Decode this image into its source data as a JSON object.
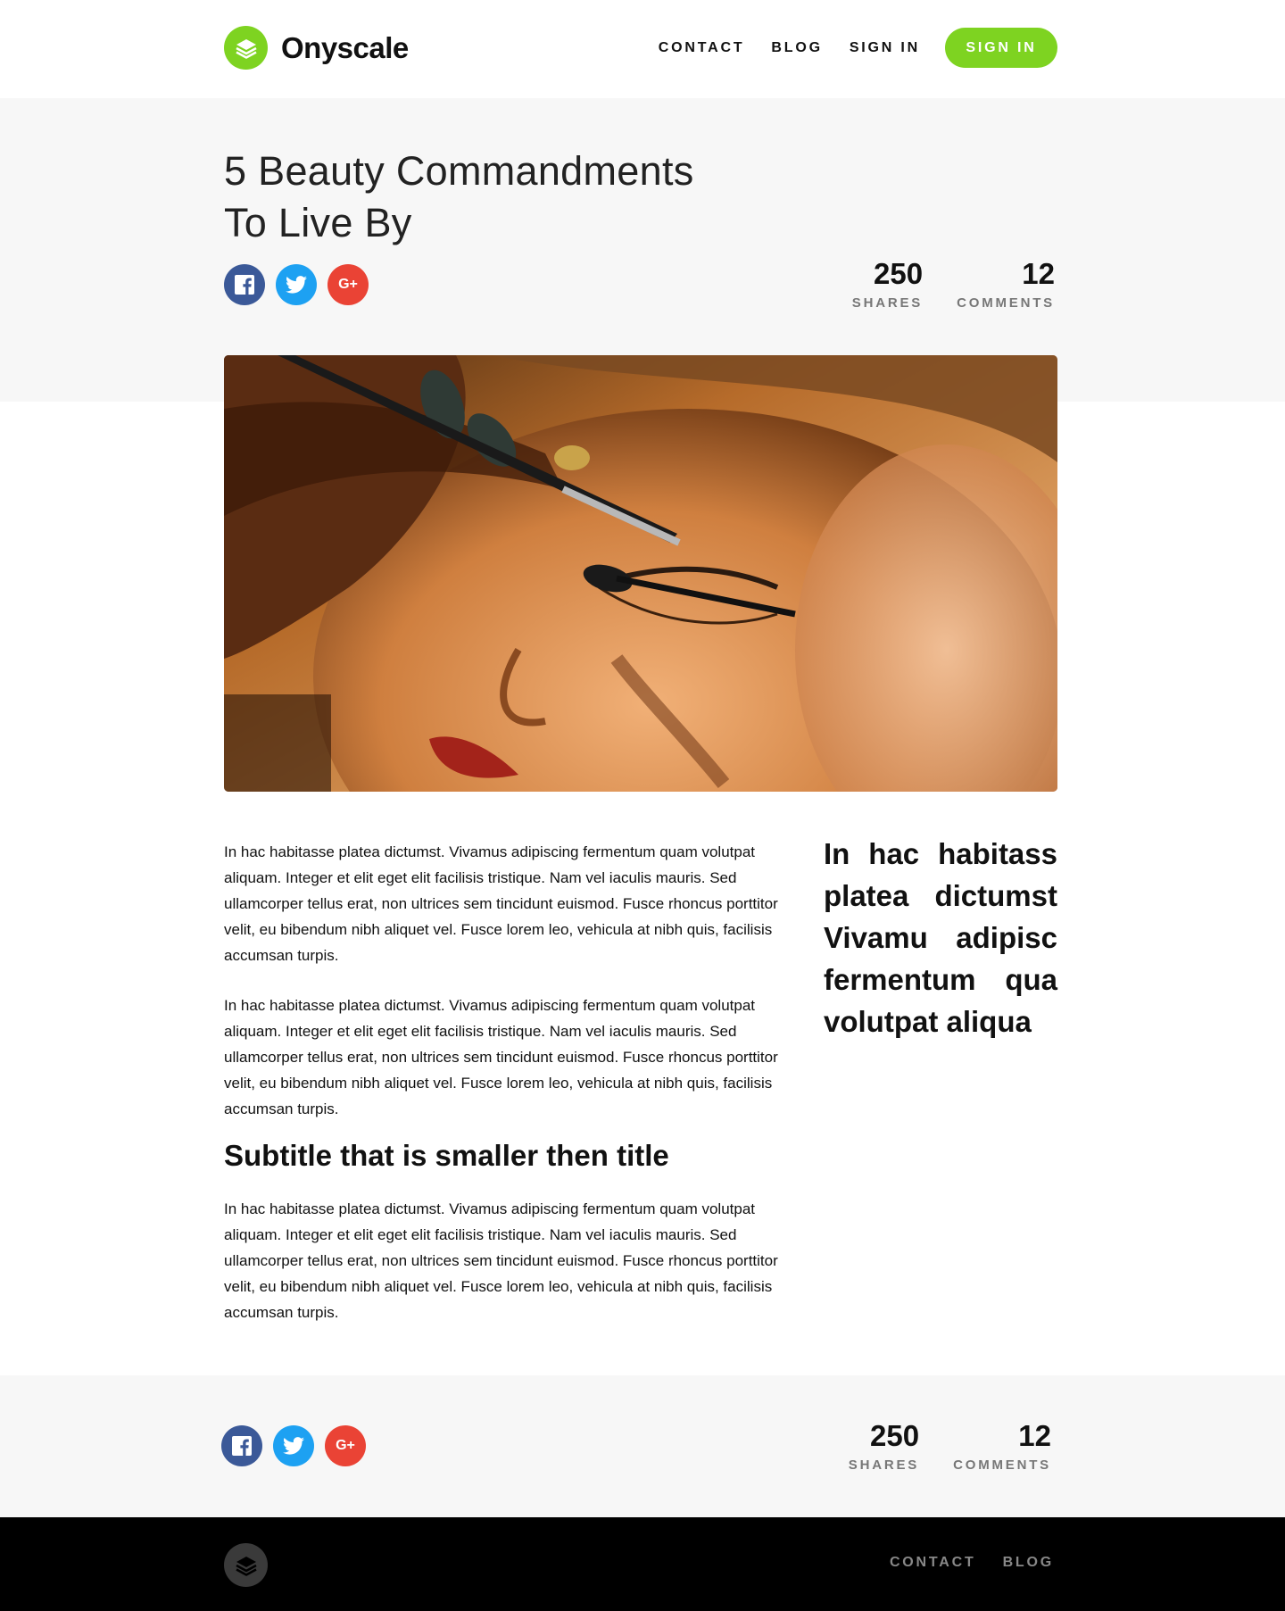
{
  "brand": {
    "name": "Onyscale",
    "color": "#7ed321"
  },
  "nav": {
    "items": [
      "CONTACT",
      "BLOG",
      "SIGN IN"
    ],
    "cta": "SIGN IN"
  },
  "article": {
    "title_line1": "5 Beauty Commandments",
    "title_line2": "To Live By",
    "hero_image": "woman-eye-makeup-photo",
    "paragraphs": [
      "In hac habitasse platea dictumst. Vivamus adipiscing fermentum quam volutpat aliquam. Integer et elit eget elit facilisis tristique. Nam vel iaculis mauris. Sed ullamcorper tellus erat, non ultrices sem tincidunt euismod. Fusce rhoncus porttitor velit, eu bibendum nibh aliquet vel. Fusce lorem leo, vehicula at nibh quis, facilisis accumsan turpis.",
      "In hac habitasse platea dictumst. Vivamus adipiscing fermentum quam volutpat aliquam. Integer et elit eget elit facilisis tristique. Nam vel iaculis mauris. Sed ullamcorper tellus erat, non ultrices sem tincidunt euismod. Fusce rhoncus porttitor velit, eu bibendum nibh aliquet vel. Fusce lorem leo, vehicula at nibh quis, facilisis accumsan turpis.",
      "In hac habitasse platea dictumst. Vivamus adipiscing fermentum quam volutpat aliquam. Integer et elit eget elit facilisis tristique. Nam vel iaculis mauris. Sed ullamcorper tellus erat, non ultrices sem tincidunt euismod. Fusce rhoncus porttitor velit, eu bibendum nibh aliquet vel. Fusce lorem leo, vehicula at nibh quis, facilisis accumsan turpis."
    ],
    "subtitle": "Subtitle that is smaller then title",
    "pull_quote": "In hac habitass platea dictumst Vivamu adipisc fermentum qua volutpat aliqua"
  },
  "social": {
    "facebook_icon": "facebook-icon",
    "twitter_icon": "twitter-icon",
    "googleplus_icon": "google-plus-icon",
    "googleplus_label": "G+",
    "colors": {
      "facebook": "#3b5998",
      "twitter": "#1da1f2",
      "googleplus": "#ea4335"
    }
  },
  "stats": {
    "shares_count": "250",
    "shares_label": "SHARES",
    "comments_count": "12",
    "comments_label": "COMMENTS"
  },
  "footer": {
    "links": [
      "CONTACT",
      "BLOG"
    ]
  }
}
